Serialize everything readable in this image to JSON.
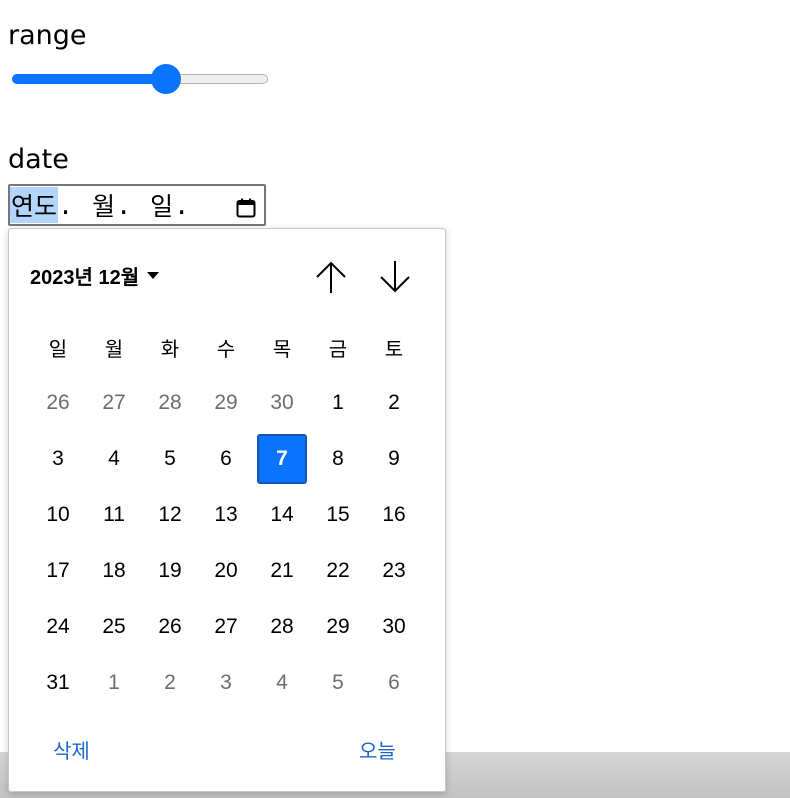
{
  "range": {
    "label": "range",
    "value_percent": 60,
    "accent_color": "#0a74ff"
  },
  "date": {
    "label": "date",
    "segments": {
      "year": "연도",
      "month": "월",
      "day": "일"
    },
    "separator": ".",
    "calendar_icon": "calendar-icon"
  },
  "calendar": {
    "month_title": "2023년 12월",
    "nav_up_icon": "arrow-up-icon",
    "nav_down_icon": "arrow-down-icon",
    "weekdays": [
      "일",
      "월",
      "화",
      "수",
      "목",
      "금",
      "토"
    ],
    "weeks": [
      [
        {
          "d": "26",
          "other": true
        },
        {
          "d": "27",
          "other": true
        },
        {
          "d": "28",
          "other": true
        },
        {
          "d": "29",
          "other": true
        },
        {
          "d": "30",
          "other": true
        },
        {
          "d": "1"
        },
        {
          "d": "2"
        }
      ],
      [
        {
          "d": "3"
        },
        {
          "d": "4"
        },
        {
          "d": "5"
        },
        {
          "d": "6"
        },
        {
          "d": "7",
          "selected": true
        },
        {
          "d": "8"
        },
        {
          "d": "9"
        }
      ],
      [
        {
          "d": "10"
        },
        {
          "d": "11"
        },
        {
          "d": "12"
        },
        {
          "d": "13"
        },
        {
          "d": "14"
        },
        {
          "d": "15"
        },
        {
          "d": "16"
        }
      ],
      [
        {
          "d": "17"
        },
        {
          "d": "18"
        },
        {
          "d": "19"
        },
        {
          "d": "20"
        },
        {
          "d": "21"
        },
        {
          "d": "22"
        },
        {
          "d": "23"
        }
      ],
      [
        {
          "d": "24"
        },
        {
          "d": "25"
        },
        {
          "d": "26"
        },
        {
          "d": "27"
        },
        {
          "d": "28"
        },
        {
          "d": "29"
        },
        {
          "d": "30"
        }
      ],
      [
        {
          "d": "31"
        },
        {
          "d": "1",
          "other": true
        },
        {
          "d": "2",
          "other": true
        },
        {
          "d": "3",
          "other": true
        },
        {
          "d": "4",
          "other": true
        },
        {
          "d": "5",
          "other": true
        },
        {
          "d": "6",
          "other": true
        }
      ]
    ],
    "clear_label": "삭제",
    "today_label": "오늘",
    "selected_color": "#0a74ff",
    "link_color": "#1a66c8"
  }
}
